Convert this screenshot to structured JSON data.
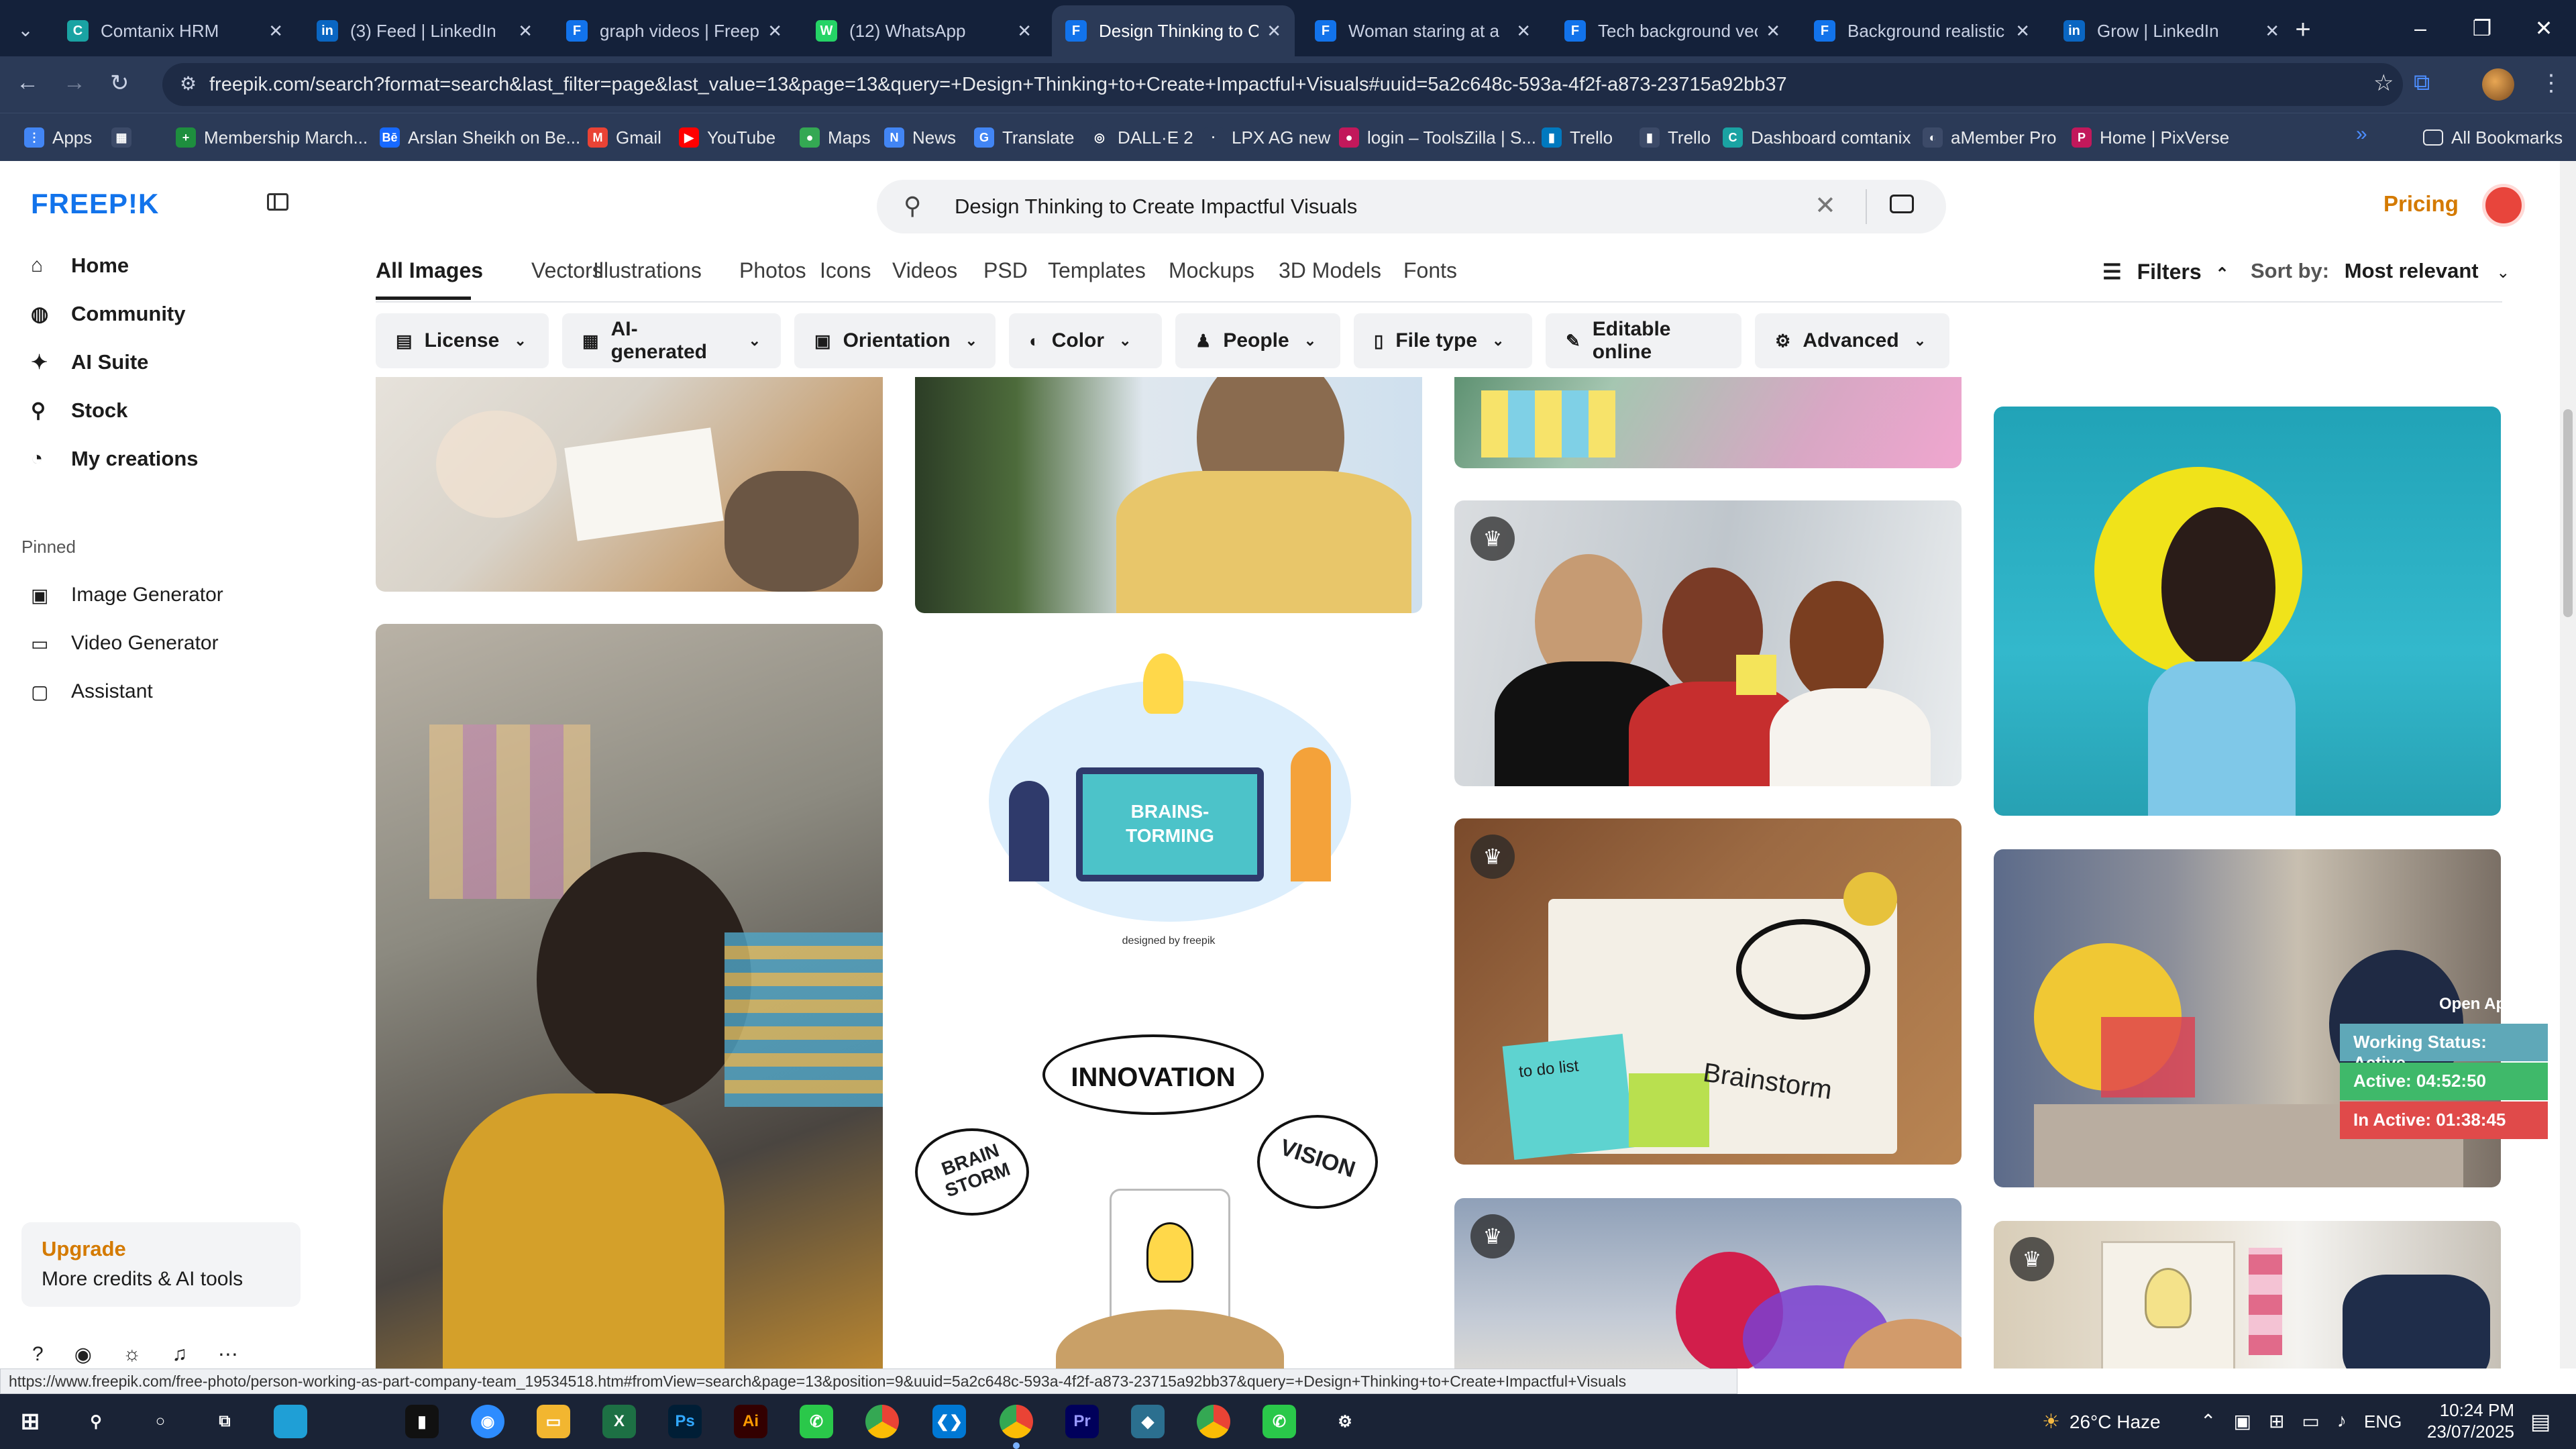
{
  "browser": {
    "tabs": [
      {
        "title": "Comtanix HRM",
        "icon": "comtanix-icon",
        "color": "#1aa3a3",
        "glyph": "C"
      },
      {
        "title": "(3) Feed | LinkedIn",
        "icon": "linkedin-icon",
        "color": "#0a66c2",
        "glyph": "in"
      },
      {
        "title": "graph videos | Freepik",
        "icon": "freepik-icon",
        "color": "#1273eb",
        "glyph": "F"
      },
      {
        "title": "(12) WhatsApp",
        "icon": "whatsapp-icon",
        "color": "#25d366",
        "glyph": "W"
      },
      {
        "title": "Design Thinking to C",
        "icon": "freepik-icon",
        "color": "#1273eb",
        "glyph": "F"
      },
      {
        "title": "Woman staring at a",
        "icon": "freepik-icon",
        "color": "#1273eb",
        "glyph": "F"
      },
      {
        "title": "Tech background vec",
        "icon": "freepik-icon",
        "color": "#1273eb",
        "glyph": "F"
      },
      {
        "title": "Background realistic",
        "icon": "freepik-icon",
        "color": "#1273eb",
        "glyph": "F"
      },
      {
        "title": "Grow | LinkedIn",
        "icon": "linkedin-icon",
        "color": "#0a66c2",
        "glyph": "in"
      }
    ],
    "url": "freepik.com/search?format=search&last_filter=page&last_value=13&page=13&query=+Design+Thinking+to+Create+Impactful+Visuals#uuid=5a2c648c-593a-4f2f-a873-23715a92bb37",
    "bookmarks": [
      {
        "label": "Apps",
        "icon": "apps-grid-icon",
        "color": "#4285f4",
        "glyph": "⋮"
      },
      {
        "label": "",
        "icon": "grid-icon",
        "color": "#3c4a68",
        "glyph": "▦"
      },
      {
        "label": "Membership March...",
        "icon": "bookmark-green-icon",
        "color": "#1e8e3e",
        "glyph": "+"
      },
      {
        "label": "Arslan Sheikh on Be...",
        "icon": "behance-icon",
        "color": "#1769ff",
        "glyph": "Bē"
      },
      {
        "label": "Gmail",
        "icon": "gmail-icon",
        "color": "#ea4335",
        "glyph": "M"
      },
      {
        "label": "YouTube",
        "icon": "youtube-icon",
        "color": "#ff0000",
        "glyph": "▶"
      },
      {
        "label": "Maps",
        "icon": "maps-icon",
        "color": "#34a853",
        "glyph": "●"
      },
      {
        "label": "News",
        "icon": "news-icon",
        "color": "#4285f4",
        "glyph": "N"
      },
      {
        "label": "Translate",
        "icon": "translate-icon",
        "color": "#4285f4",
        "glyph": "G"
      },
      {
        "label": "DALL·E 2",
        "icon": "openai-icon",
        "color": "#2b3a57",
        "glyph": "◎"
      },
      {
        "label": "LPX AG new",
        "icon": "bookmark-icon",
        "color": "#2b3a57",
        "glyph": "·"
      },
      {
        "label": "login – ToolsZilla | S...",
        "icon": "toolszilla-icon",
        "color": "#c2185b",
        "glyph": "●"
      },
      {
        "label": "Trello",
        "icon": "trello-icon",
        "color": "#0079bf",
        "glyph": "▮"
      },
      {
        "label": "Trello",
        "icon": "trello-icon",
        "color": "#3c4a68",
        "glyph": "▮"
      },
      {
        "label": "Dashboard comtanix",
        "icon": "comtanix-icon",
        "color": "#1aa3a3",
        "glyph": "C"
      },
      {
        "label": "aMember Pro",
        "icon": "amember-icon",
        "color": "#3c4a68",
        "glyph": "◐"
      },
      {
        "label": "Home | PixVerse",
        "icon": "pixverse-icon",
        "color": "#c2185b",
        "glyph": "P"
      }
    ],
    "all_bookmarks": "All Bookmarks",
    "status_url": "https://www.freepik.com/free-photo/person-working-as-part-company-team_19534518.htm#fromView=search&page=13&position=9&uuid=5a2c648c-593a-4f2f-a873-23715a92bb37&query=+Design+Thinking+to+Create+Impactful+Visuals"
  },
  "sidebar": {
    "logo": "FREEP!K",
    "nav": [
      {
        "label": "Home",
        "icon": "home-icon",
        "glyph": "⌂"
      },
      {
        "label": "Community",
        "icon": "community-icon",
        "glyph": "◍"
      },
      {
        "label": "AI Suite",
        "icon": "sparkle-icon",
        "glyph": "✦"
      },
      {
        "label": "Stock",
        "icon": "search-icon",
        "glyph": "⚲"
      },
      {
        "label": "My creations",
        "icon": "creations-icon",
        "glyph": "◔"
      }
    ],
    "pinned_heading": "Pinned",
    "pinned": [
      {
        "label": "Image Generator",
        "icon": "image-icon",
        "glyph": "▣"
      },
      {
        "label": "Video Generator",
        "icon": "video-icon",
        "glyph": "▭"
      },
      {
        "label": "Assistant",
        "icon": "chat-icon",
        "glyph": "▢"
      }
    ],
    "upgrade": {
      "title": "Upgrade",
      "subtitle": "More credits & AI tools"
    }
  },
  "header": {
    "search_value": "Design Thinking to Create Impactful Visuals",
    "pricing": "Pricing"
  },
  "categories": [
    "All Images",
    "Vectors",
    "Illustrations",
    "Photos",
    "Icons",
    "Videos",
    "PSD",
    "Templates",
    "Mockups",
    "3D Models",
    "Fonts"
  ],
  "filters_label": "Filters",
  "sort_label": "Sort by:",
  "sort_value": "Most relevant",
  "filter_chips": [
    {
      "label": "License",
      "icon": "license-icon",
      "glyph": "▤"
    },
    {
      "label": "AI-generated",
      "icon": "ai-icon",
      "glyph": "▦"
    },
    {
      "label": "Orientation",
      "icon": "orientation-icon",
      "glyph": "▣"
    },
    {
      "label": "Color",
      "icon": "palette-icon",
      "glyph": "◐"
    },
    {
      "label": "People",
      "icon": "people-icon",
      "glyph": "♟"
    },
    {
      "label": "File type",
      "icon": "file-icon",
      "glyph": "▯"
    },
    {
      "label": "Editable online",
      "icon": "pen-icon",
      "glyph": "✎"
    },
    {
      "label": "Advanced",
      "icon": "gear-icon",
      "glyph": "⚙"
    }
  ],
  "results": {
    "brainstorm_words": {
      "a": "BRAINS-",
      "b": "TORMING",
      "credit": "designed by freepik"
    },
    "innovation_words": {
      "center": "INNOVATION",
      "left": "BRAIN STORM",
      "right": "VISION"
    },
    "notebook_text": {
      "main": "Brainstorm",
      "note": "to do list"
    },
    "open_app": "Open App ↗"
  },
  "work_status": {
    "status": "Working Status: Active",
    "active": "Active: 04:52:50",
    "inactive": "In Active: 01:38:45"
  },
  "taskbar": {
    "weather": "26°C Haze",
    "lang": "ENG",
    "time": "10:24 PM",
    "date": "23/07/2025"
  }
}
